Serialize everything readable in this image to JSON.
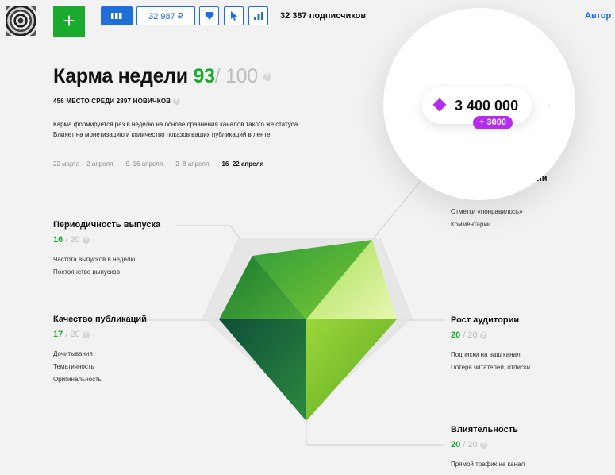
{
  "topbar": {
    "add_label": "+",
    "balance": "32 987 ₽",
    "subscribers": "32 387 подписчиков",
    "author_link": "Автор",
    "icons": [
      "grid-icon",
      "gem-icon",
      "cursor-icon",
      "stats-icon"
    ]
  },
  "karma": {
    "title": "Карма недели",
    "score": "93",
    "max": "/ 100",
    "rank": "456 МЕСТО СРЕДИ 2897 НОВИЧКОВ",
    "desc_line1": "Карма формируется раз в неделю на основе сравнения каналов такого же статуса.",
    "desc_line2": "Влияет на монетизацию и количество показов ваших публикаций в ленте.",
    "periods": [
      "22 марта – 2 апреля",
      "9–16 апреля",
      "2–8 апреля",
      "16–22 апреля"
    ],
    "active_period": 3
  },
  "metrics": {
    "periodicity": {
      "title": "Периодичность выпуска",
      "score": "16",
      "of": "/ 20",
      "items": [
        "Частота выпусков в неделю",
        "Постоянство выпусков"
      ]
    },
    "quality": {
      "title": "Качество публикаций",
      "score": "17",
      "of": "/ 20",
      "items": [
        "Дочитывания",
        "Тематичность",
        "Оригинальность"
      ]
    },
    "engagement": {
      "title_tail": "ии",
      "items": [
        "Отметки «понравилось»",
        "Комментарии"
      ]
    },
    "growth": {
      "title": "Рост аудитории",
      "score": "20",
      "of": "/ 20",
      "items": [
        "Подписки на ваш канал",
        "Потеря читателей, отписки"
      ]
    },
    "influence": {
      "title": "Влиятельность",
      "score": "20",
      "of": "/ 20",
      "items": [
        "Прямой трафик на канал"
      ]
    }
  },
  "reward": {
    "value": "3 400 000",
    "delta": "+ 3000"
  },
  "colors": {
    "accent_green": "#1aaa2e",
    "link_blue": "#1e6fd9",
    "reward_purple": "#b52cf0"
  }
}
